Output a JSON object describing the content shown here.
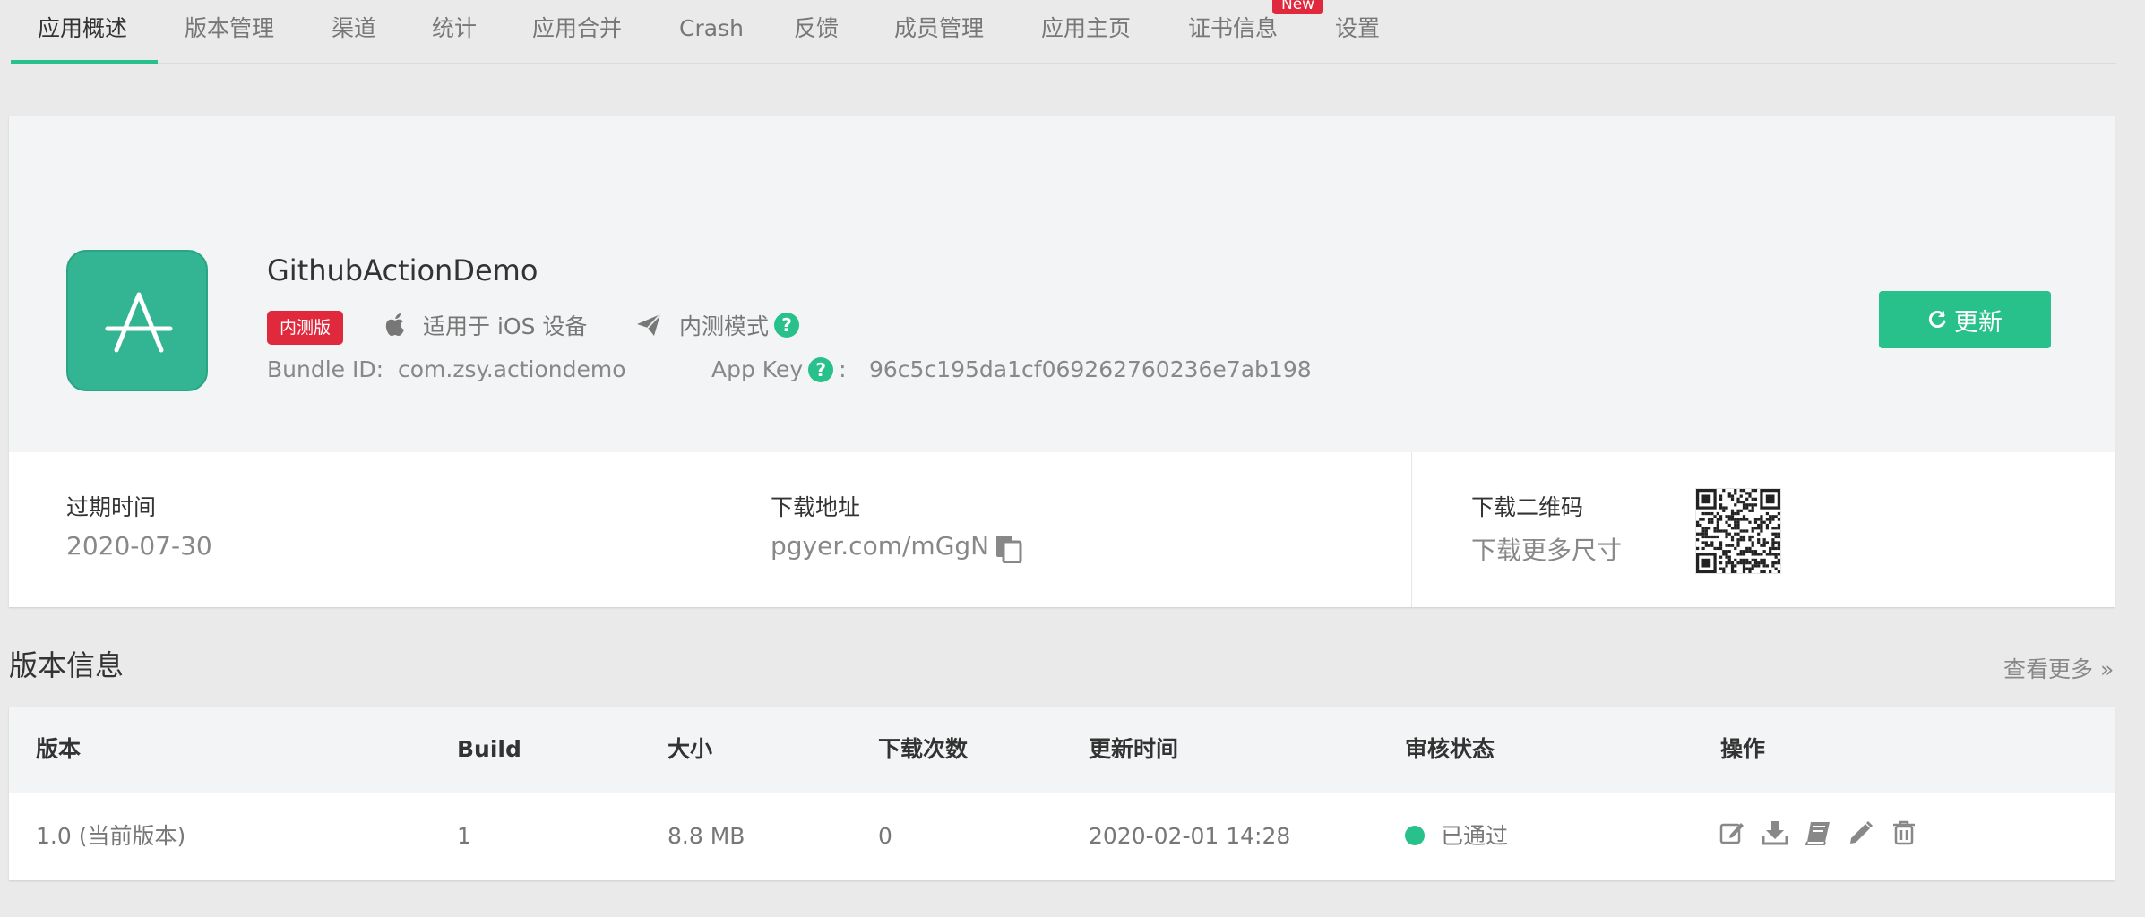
{
  "tabs": [
    {
      "label": "应用概述",
      "active": true
    },
    {
      "label": "版本管理"
    },
    {
      "label": "渠道"
    },
    {
      "label": "统计"
    },
    {
      "label": "应用合并"
    },
    {
      "label": "Crash"
    },
    {
      "label": "反馈"
    },
    {
      "label": "成员管理"
    },
    {
      "label": "应用主页"
    },
    {
      "label": "证书信息"
    },
    {
      "label": "设置"
    }
  ],
  "new_badge": "New",
  "app": {
    "name": "GithubActionDemo",
    "icon": "app-store-a-icon",
    "badge": "内测版",
    "platform": "适用于 iOS 设备",
    "mode": "内测模式",
    "bundle_label": "Bundle ID:",
    "bundle_id": "com.zsy.actiondemo",
    "appkey_label": "App Key",
    "appkey_sep": ":",
    "app_key": "96c5c195da1cf069262760236e7ab198",
    "update_label": "更新"
  },
  "stats": {
    "expire_title": "过期时间",
    "expire_value": "2020-07-30",
    "download_title": "下载地址",
    "download_value": "pgyer.com/mGgN",
    "qr_title": "下载二维码",
    "qr_value": "下载更多尺寸"
  },
  "versions": {
    "title": "版本信息",
    "more": "查看更多 »",
    "columns": [
      "版本",
      "Build",
      "大小",
      "下载次数",
      "更新时间",
      "审核状态",
      "操作"
    ],
    "rows": [
      {
        "version": "1.0 (当前版本)",
        "build": "1",
        "size": "8.8 MB",
        "downloads": "0",
        "updated": "2020-02-01 14:28",
        "status": "已通过"
      }
    ]
  },
  "colors": {
    "accent": "#28c08b",
    "danger": "#e0293c",
    "app_icon": "#33b594"
  }
}
